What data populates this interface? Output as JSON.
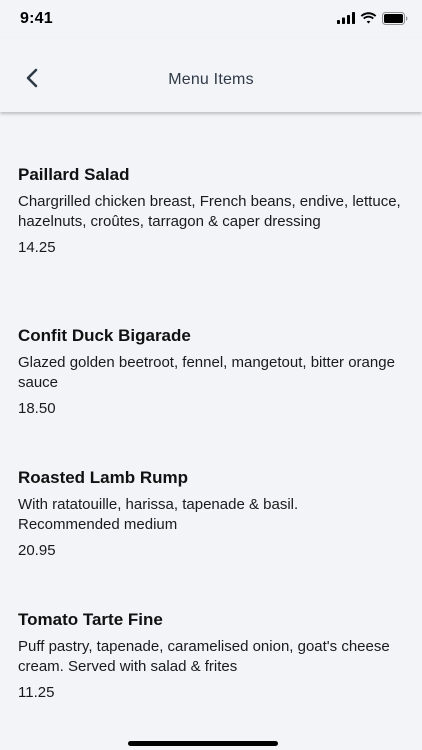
{
  "status_bar": {
    "time": "9:41",
    "icons": [
      "cellular-signal-icon",
      "wifi-icon",
      "battery-icon"
    ]
  },
  "nav": {
    "back_icon": "chevron-left-icon",
    "title": "Menu Items"
  },
  "menu_items": [
    {
      "name": "Paillard Salad",
      "description": "Chargrilled chicken breast, French beans, endive, lettuce, hazelnuts, croûtes, tarragon & caper dressing",
      "price": "14.25"
    },
    {
      "name": "Confit Duck Bigarade",
      "description": "Glazed golden beetroot, fennel, mangetout, bitter orange sauce",
      "price": "18.50"
    },
    {
      "name": "Roasted Lamb Rump",
      "description": "With ratatouille, harissa, tapenade & basil. Recommended medium",
      "price": "20.95"
    },
    {
      "name": "Tomato Tarte Fine",
      "description": "Puff pastry, tapenade, caramelised onion, goat's cheese cream. Served with salad & frites",
      "price": "11.25"
    }
  ],
  "colors": {
    "background": "#f2f4f8",
    "nav_title": "#2f3a47",
    "text": "#111111"
  }
}
